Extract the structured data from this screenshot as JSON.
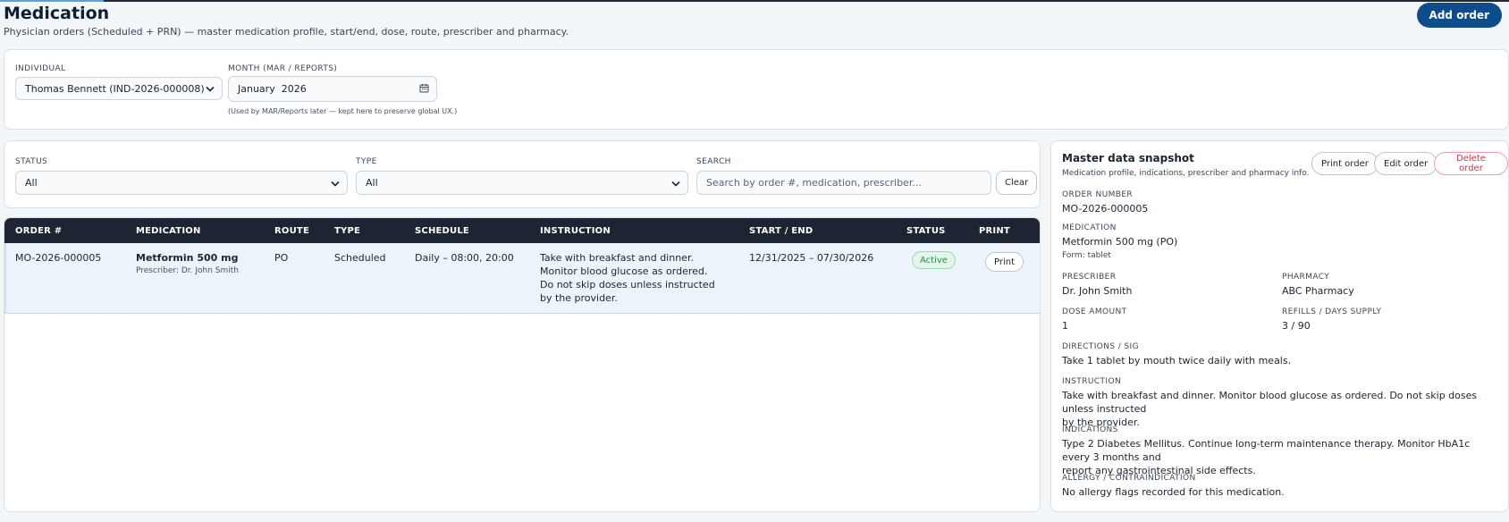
{
  "header": {
    "title": "Medication",
    "subtitle": "Physician orders (Scheduled + PRN) — master medication profile, start/end, dose, route, prescriber and pharmacy.",
    "add_order_label": "Add order"
  },
  "context": {
    "individual_label": "INDIVIDUAL",
    "individual_value": "Thomas Bennett (IND-2026-000008)",
    "month_label": "MONTH (MAR / REPORTS)",
    "month_value": "January  2026",
    "month_hint": "(Used by MAR/Reports later — kept here to preserve global UX.)"
  },
  "filters": {
    "status_label": "STATUS",
    "status_value": "All",
    "type_label": "TYPE",
    "type_value": "All",
    "search_label": "SEARCH",
    "search_placeholder": "Search by order #, medication, prescriber...",
    "clear_label": "Clear"
  },
  "table": {
    "columns": [
      "ORDER #",
      "MEDICATION",
      "ROUTE",
      "TYPE",
      "SCHEDULE",
      "INSTRUCTION",
      "START / END",
      "STATUS",
      "PRINT"
    ],
    "rows": [
      {
        "order_number": "MO-2026-000005",
        "medication": "Metformin 500 mg",
        "prescriber": "Prescriber: Dr. John Smith",
        "route": "PO",
        "type": "Scheduled",
        "schedule": "Daily – 08:00, 20:00",
        "instruction_lines": [
          "Take with breakfast and dinner.",
          "Monitor blood glucose as ordered.",
          "Do not skip doses unless instructed",
          "by the provider."
        ],
        "start_end": "12/31/2025 – 07/30/2026",
        "status": "Active",
        "print_label": "Print"
      }
    ]
  },
  "snapshot": {
    "title": "Master data snapshot",
    "subtitle": "Medication profile, indications, prescriber and pharmacy info.",
    "print_label": "Print order",
    "edit_label": "Edit order",
    "delete_label": "Delete order",
    "order_number_label": "ORDER NUMBER",
    "order_number": "MO-2026-000005",
    "medication_label": "MEDICATION",
    "medication": "Metformin 500 mg (PO)",
    "form": "Form: tablet",
    "prescriber_label": "PRESCRIBER",
    "prescriber": "Dr. John Smith",
    "pharmacy_label": "PHARMACY",
    "pharmacy": "ABC Pharmacy",
    "dose_label": "DOSE AMOUNT",
    "dose": "1",
    "refills_label": "REFILLS / DAYS SUPPLY",
    "refills": "3 / 90",
    "directions_label": "DIRECTIONS / SIG",
    "directions": "Take 1 tablet by mouth twice daily with meals.",
    "instruction_label": "INSTRUCTION",
    "instruction_lines": [
      "Take with breakfast and dinner. Monitor blood glucose as ordered. Do not skip doses unless instructed",
      "by the provider."
    ],
    "indications_label": "INDICATIONS",
    "indications_lines": [
      "Type 2 Diabetes Mellitus. Continue long-term maintenance therapy. Monitor HbA1c every 3 months and",
      "report any gastrointestinal side effects."
    ],
    "allergy_label": "ALLERGY / CONTRAINDICATION",
    "allergy": "No allergy flags recorded for this medication."
  },
  "colors": {
    "primary": "#0d4d8c",
    "header_dark": "#1c2531",
    "active_green": "#2f8a4b",
    "danger_red": "#c23b3b"
  }
}
